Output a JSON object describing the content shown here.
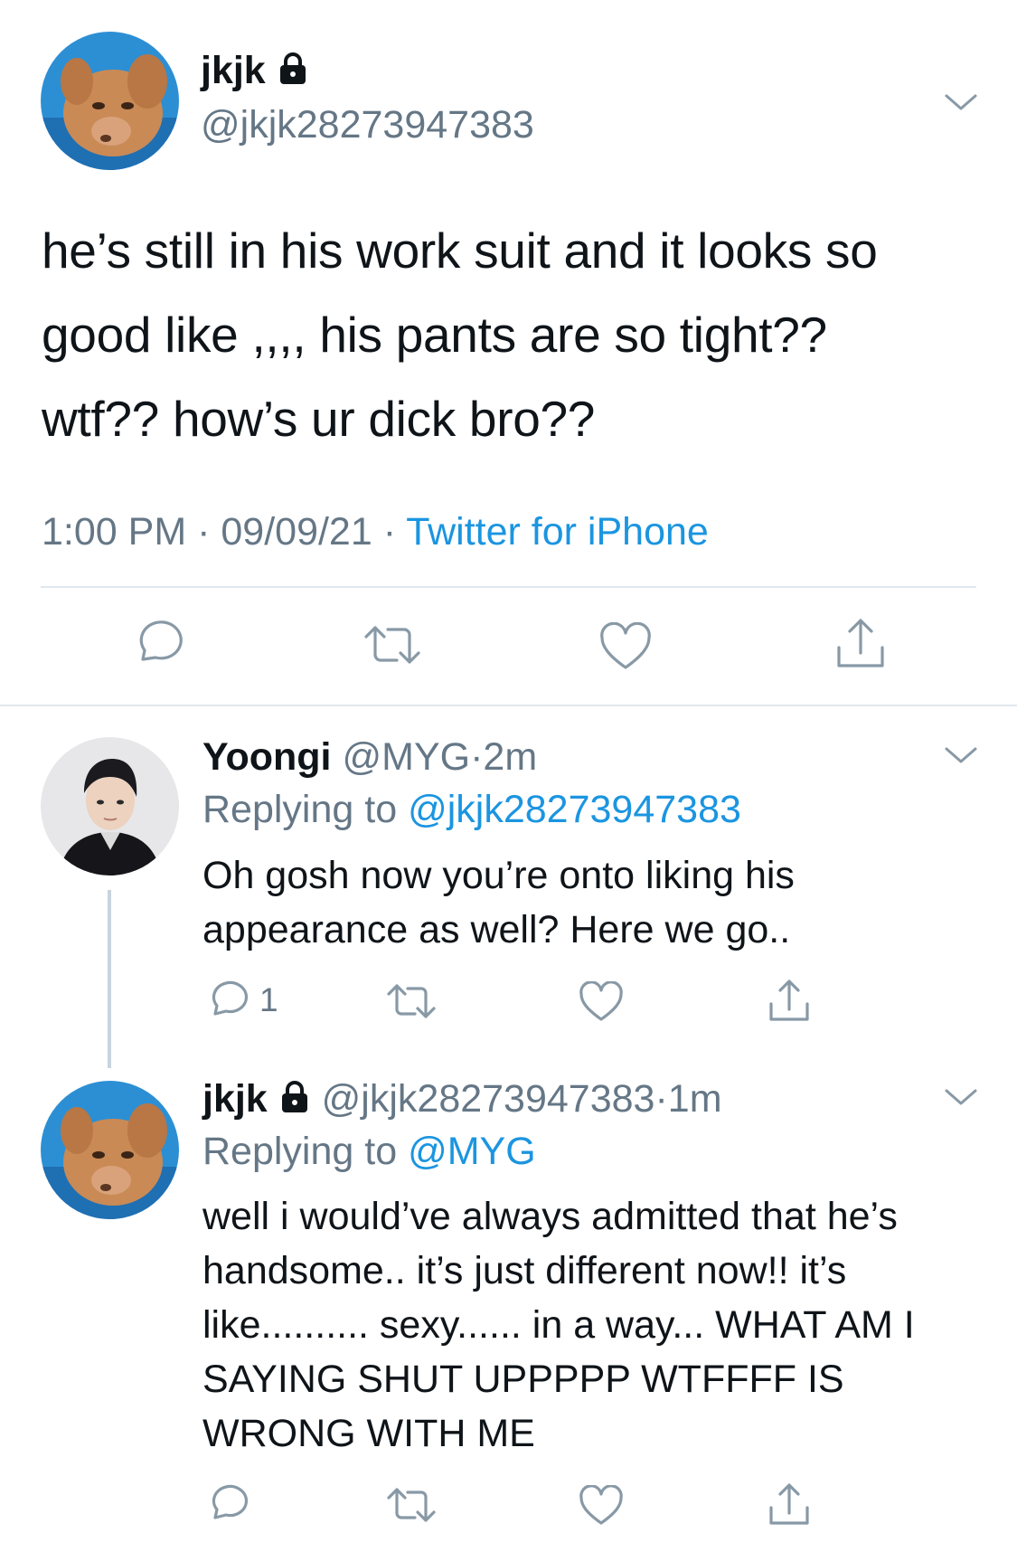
{
  "main_tweet": {
    "display_name": "jkjk",
    "handle": "@jkjk28273947383",
    "text_lines": [
      "he’s still in his work suit and it looks so",
      "good like ,,,, his pants are so tight??",
      "wtf?? how’s ur dick bro??"
    ],
    "time": "1:00 PM",
    "date": "09/09/21",
    "separator": "·",
    "source": "Twitter for iPhone"
  },
  "reply_1": {
    "display_name": "Yoongi",
    "handle": "@MYG",
    "age": "2m",
    "replying_prefix": "Replying to ",
    "replying_handle": "@jkjk28273947383",
    "text_lines": [
      "Oh gosh now you’re onto liking his",
      "appearance as well? Here we go.."
    ],
    "reply_count": "1"
  },
  "reply_2": {
    "display_name": "jkjk",
    "handle": "@jkjk28273947383",
    "age": "1m",
    "replying_prefix": "Replying to ",
    "replying_handle": "@MYG",
    "text_lines": [
      "well i would’ve always admitted that he’s",
      "handsome.. it’s just different now!! it’s",
      "like.......... sexy...... in a way... WHAT AM I",
      "SAYING SHUT UPPPPP WTFFFF IS",
      "WRONG WITH ME"
    ]
  },
  "icons": {
    "reply": "reply-icon",
    "retweet": "retweet-icon",
    "like": "heart-icon",
    "share": "share-icon",
    "more": "chevron-down-icon",
    "protected": "lock-icon"
  },
  "colors": {
    "link": "#1b95e0",
    "secondary_text": "#657786",
    "icon": "#8899a6",
    "divider": "#e1e8ed"
  }
}
